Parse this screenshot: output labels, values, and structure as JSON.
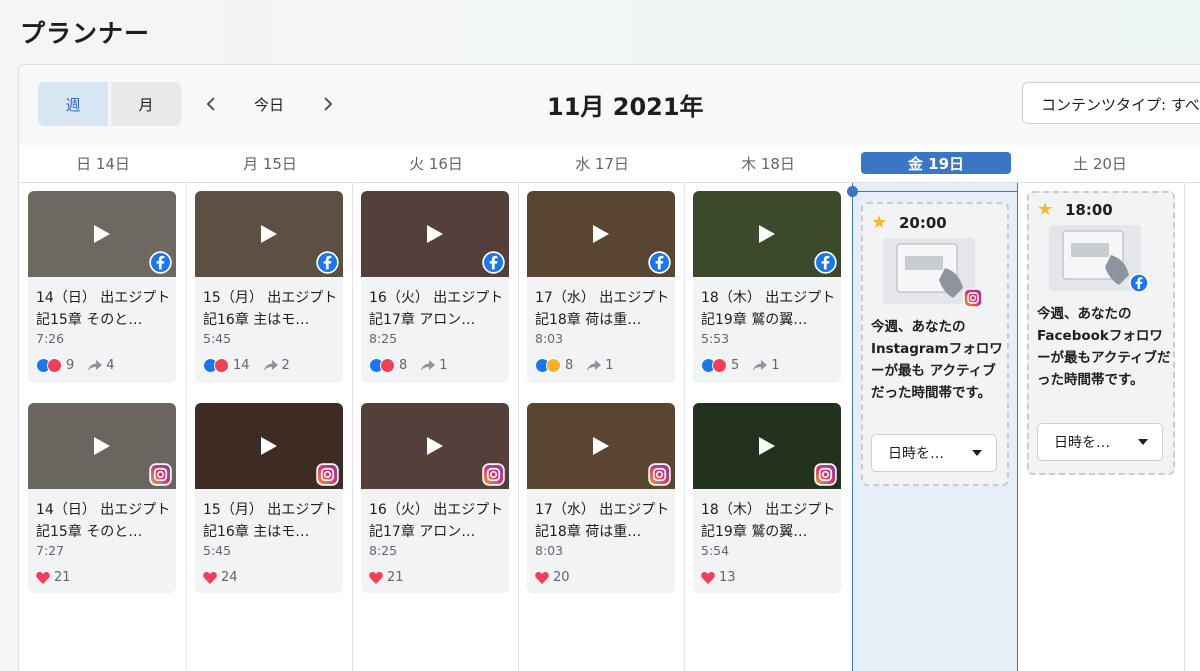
{
  "page": {
    "title": "プランナー"
  },
  "toolbar": {
    "week_label": "週",
    "month_label": "月",
    "today_label": "今日",
    "month_title": "11月 2021年",
    "content_type": "コンテンツタイプ: すべて"
  },
  "days": [
    {
      "label": "日 14日"
    },
    {
      "label": "月 15日"
    },
    {
      "label": "火 16日"
    },
    {
      "label": "水 17日"
    },
    {
      "label": "木 18日"
    },
    {
      "label": "金 19日",
      "active": true
    },
    {
      "label": "土 20日"
    }
  ],
  "facebook_posts": [
    {
      "title": "14（日） 出エジプト記15章 そのと…",
      "duration": "7:26",
      "reactions": "9",
      "shares": "4",
      "reaction_set": [
        "like",
        "love"
      ],
      "thumb_color": "#6e6960"
    },
    {
      "title": "15（月） 出エジプト記16章 主はモ…",
      "duration": "5:45",
      "reactions": "14",
      "shares": "2",
      "reaction_set": [
        "like",
        "love"
      ],
      "thumb_color": "#5c5042"
    },
    {
      "title": "16（火） 出エジプト記17章 アロン…",
      "duration": "8:25",
      "reactions": "8",
      "shares": "1",
      "reaction_set": [
        "like",
        "love"
      ],
      "thumb_color": "#553f3b"
    },
    {
      "title": "17（水） 出エジプト記18章 荷は重…",
      "duration": "8:03",
      "reactions": "8",
      "shares": "1",
      "reaction_set": [
        "like",
        "care"
      ],
      "thumb_color": "#5a4630"
    },
    {
      "title": "18（木） 出エジプト記19章 鷲の翼…",
      "duration": "5:53",
      "reactions": "5",
      "shares": "1",
      "reaction_set": [
        "like",
        "love"
      ],
      "thumb_color": "#3c4a2c"
    }
  ],
  "instagram_posts": [
    {
      "title": "14（日） 出エジプト記15章 そのと…",
      "duration": "7:27",
      "likes": "21",
      "thumb_color": "#6a655e"
    },
    {
      "title": "15（月） 出エジプト記16章 主はモ…",
      "duration": "5:45",
      "likes": "24",
      "thumb_color": "#3e2c24"
    },
    {
      "title": "16（火） 出エジプト記17章 アロン…",
      "duration": "8:25",
      "likes": "21",
      "thumb_color": "#553f3b"
    },
    {
      "title": "17（水） 出エジプト記18章 荷は重…",
      "duration": "8:03",
      "likes": "20",
      "thumb_color": "#5a4630"
    },
    {
      "title": "18（木） 出エジプト記19章 鷲の翼…",
      "duration": "5:54",
      "likes": "13",
      "thumb_color": "#23311f"
    }
  ],
  "suggestions": [
    {
      "time": "20:00",
      "text": "今週、あなたのInstagramフォロワーが最も アクティブだった時間帯です。",
      "button": "日時を…",
      "network": "instagram-icon"
    },
    {
      "time": "18:00",
      "text": "今週、あなたのFacebookフォロワーが最もアクティブだった時間帯です。",
      "button": "日時を…",
      "network": "facebook-icon"
    }
  ],
  "colors": {
    "accent": "#3a76c4",
    "facebook": "#1877f2",
    "love": "#f33e58",
    "today_bg": "#e6eef8"
  }
}
